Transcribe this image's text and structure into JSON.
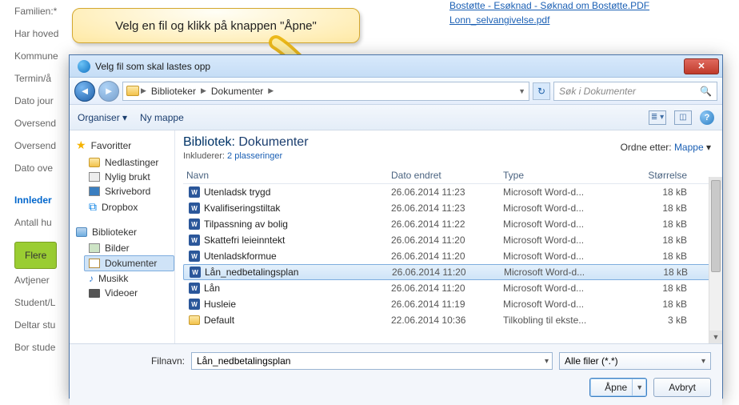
{
  "background": {
    "fields": [
      "Familien:*",
      "Har hoved",
      "Kommune",
      "Termin/å",
      "Dato jour",
      "Oversend",
      "Oversend",
      "Dato ove"
    ],
    "heading": "Innleder",
    "antall": "Antall hu",
    "flere": "Flere",
    "rest": [
      "Avtjener",
      "Student/L",
      "Deltar stu",
      "Bor stude"
    ]
  },
  "bg_links": {
    "l1": "Bostøtte - Esøknad - Søknad om Bostøtte.PDF",
    "l2": "Lonn_selvangivelse.pdf"
  },
  "callout": "Velg en fil og klikk på knappen \"Åpne\"",
  "dialog": {
    "title": "Velg fil som skal lastes opp",
    "breadcrumb": {
      "root": "Biblioteker",
      "folder": "Dokumenter"
    },
    "search_placeholder": "Søk i Dokumenter",
    "toolbar": {
      "organize": "Organiser",
      "newfolder": "Ny mappe"
    },
    "library": {
      "title_prefix": "Bibliotek:",
      "title_name": "Dokumenter",
      "sub_label": "Inkluderer:",
      "sub_link": "2 plasseringer",
      "orderby_label": "Ordne etter:",
      "orderby_value": "Mappe"
    },
    "nav": {
      "fav": "Favoritter",
      "fav_items": [
        "Nedlastinger",
        "Nylig brukt",
        "Skrivebord",
        "Dropbox"
      ],
      "lib": "Biblioteker",
      "lib_items": [
        "Bilder",
        "Dokumenter",
        "Musikk",
        "Videoer"
      ]
    },
    "columns": {
      "name": "Navn",
      "date": "Dato endret",
      "type": "Type",
      "size": "Størrelse"
    },
    "files": [
      {
        "icon": "word",
        "name": "Utenladsk trygd",
        "date": "26.06.2014 11:23",
        "type": "Microsoft Word-d...",
        "size": "18 kB"
      },
      {
        "icon": "word",
        "name": "Kvalifiseringstiltak",
        "date": "26.06.2014 11:23",
        "type": "Microsoft Word-d...",
        "size": "18 kB"
      },
      {
        "icon": "word",
        "name": "Tilpassning av bolig",
        "date": "26.06.2014 11:22",
        "type": "Microsoft Word-d...",
        "size": "18 kB"
      },
      {
        "icon": "word",
        "name": "Skattefri leieinntekt",
        "date": "26.06.2014 11:20",
        "type": "Microsoft Word-d...",
        "size": "18 kB"
      },
      {
        "icon": "word",
        "name": "Utenladskformue",
        "date": "26.06.2014 11:20",
        "type": "Microsoft Word-d...",
        "size": "18 kB"
      },
      {
        "icon": "word",
        "name": "Lån_nedbetalingsplan",
        "date": "26.06.2014 11:20",
        "type": "Microsoft Word-d...",
        "size": "18 kB",
        "selected": true
      },
      {
        "icon": "word",
        "name": "Lån",
        "date": "26.06.2014 11:20",
        "type": "Microsoft Word-d...",
        "size": "18 kB"
      },
      {
        "icon": "word",
        "name": "Husleie",
        "date": "26.06.2014 11:19",
        "type": "Microsoft Word-d...",
        "size": "18 kB"
      },
      {
        "icon": "folder",
        "name": "Default",
        "date": "22.06.2014 10:36",
        "type": "Tilkobling til ekste...",
        "size": "3 kB"
      }
    ],
    "footer": {
      "filename_label": "Filnavn:",
      "filename_value": "Lån_nedbetalingsplan",
      "filetype": "Alle filer (*.*)",
      "open": "Åpne",
      "cancel": "Avbryt"
    }
  }
}
